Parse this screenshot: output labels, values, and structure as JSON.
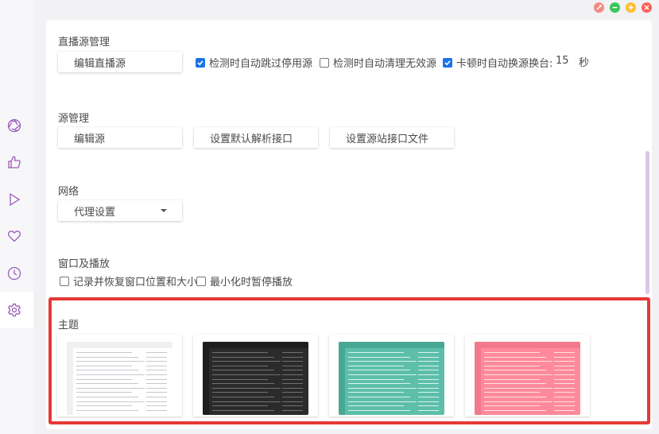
{
  "window": {
    "controls": [
      {
        "name": "pin",
        "color": "#f28b82"
      },
      {
        "name": "minimize",
        "color": "#34c759"
      },
      {
        "name": "maximize",
        "color": "#ffbd2e"
      },
      {
        "name": "close",
        "color": "#ff5f57"
      }
    ]
  },
  "sidebar": {
    "accent": "#9b5bb8",
    "items": [
      {
        "name": "aperture-icon"
      },
      {
        "name": "thumbs-up-icon"
      },
      {
        "name": "play-icon"
      },
      {
        "name": "heart-icon"
      },
      {
        "name": "clock-icon"
      },
      {
        "name": "gear-icon"
      }
    ]
  },
  "live_source": {
    "title": "直播源管理",
    "edit_button": "编辑直播源",
    "skip_disabled": {
      "label": "检测时自动跳过停用源",
      "checked": true
    },
    "clean_invalid": {
      "label": "检测时自动清理无效源",
      "checked": false
    },
    "auto_switch": {
      "label": "卡顿时自动换源换台:",
      "checked": true
    },
    "seconds_value": "15",
    "seconds_unit": "秒"
  },
  "source_mgmt": {
    "title": "源管理",
    "buttons": [
      "编辑源",
      "设置默认解析接口",
      "设置源站接口文件"
    ]
  },
  "network": {
    "title": "网络",
    "proxy_select": "代理设置"
  },
  "window_playback": {
    "title": "窗口及播放",
    "remember_window": {
      "label": "记录并恢复窗口位置和大小",
      "checked": false
    },
    "pause_minimized": {
      "label": "最小化时暂停播放",
      "checked": false
    }
  },
  "theme": {
    "title": "主题",
    "options": [
      {
        "name": "light",
        "bg": "#ffffff",
        "bar": "#f0f0f0",
        "row": "#c8c8d0"
      },
      {
        "name": "dark",
        "bg": "#2b2b2b",
        "bar": "#1e1e1e",
        "row": "#707070"
      },
      {
        "name": "green",
        "bg": "#5dbfa9",
        "bar": "#48a893",
        "row": "#d8f2ec"
      },
      {
        "name": "pink",
        "bg": "#ff8a9c",
        "bar": "#f2788b",
        "row": "#ffe0e6"
      }
    ]
  }
}
